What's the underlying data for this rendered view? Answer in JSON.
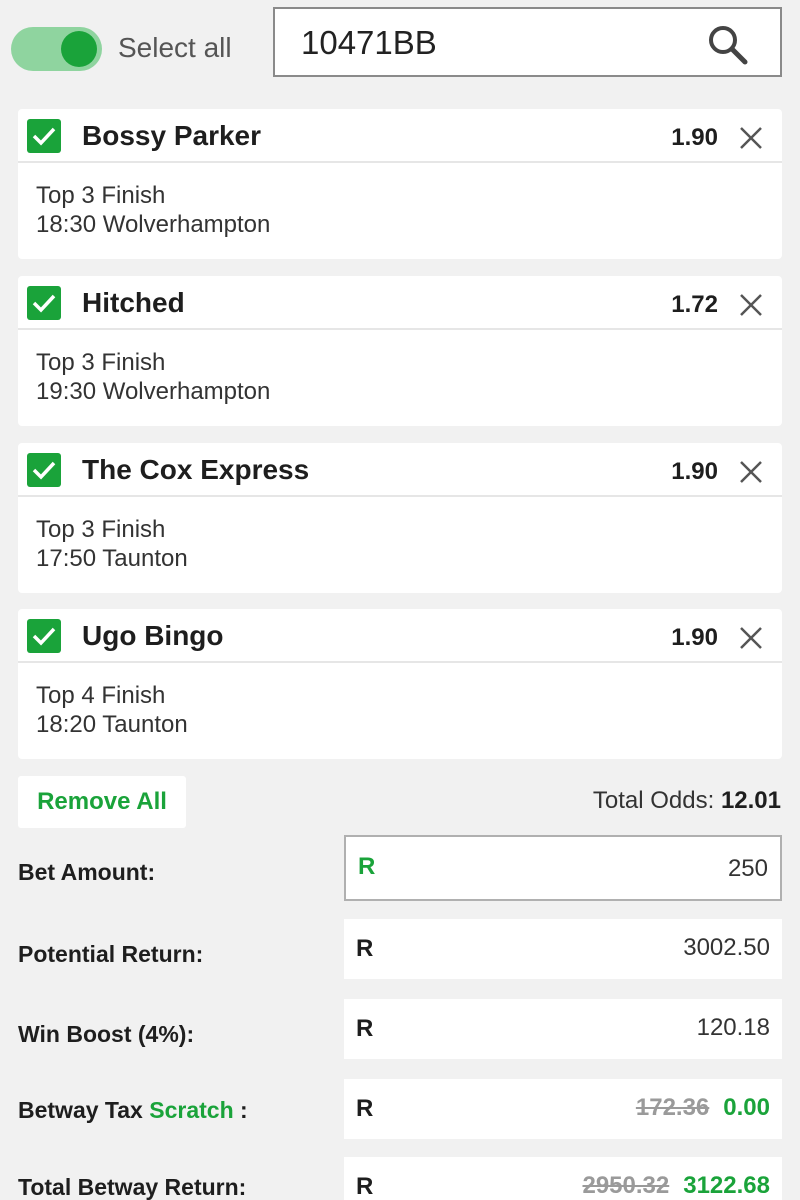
{
  "header": {
    "select_all_label": "Select all",
    "search_value": "10471BB"
  },
  "selections": [
    {
      "name": "Bossy Parker",
      "odds": "1.90",
      "market": "Top 3 Finish",
      "event": "18:30 Wolverhampton"
    },
    {
      "name": "Hitched",
      "odds": "1.72",
      "market": "Top 3 Finish",
      "event": "19:30 Wolverhampton"
    },
    {
      "name": "The Cox Express",
      "odds": "1.90",
      "market": "Top 3 Finish",
      "event": "17:50 Taunton"
    },
    {
      "name": "Ugo Bingo",
      "odds": "1.90",
      "market": "Top 4 Finish",
      "event": "18:20 Taunton"
    }
  ],
  "actions": {
    "remove_all_label": "Remove All",
    "total_odds_label": "Total Odds:",
    "total_odds_value": "12.01"
  },
  "summary": {
    "currency": "R",
    "bet_amount_label": "Bet Amount:",
    "bet_amount_value": "250",
    "potential_return_label": "Potential Return:",
    "potential_return_value": "3002.50",
    "win_boost_label": "Win Boost (4%):",
    "win_boost_value": "120.18",
    "tax_label": "Betway Tax",
    "tax_scratch": "Scratch",
    "tax_colon": " :",
    "tax_old": "172.36",
    "tax_new": "0.00",
    "total_label": "Total Betway Return:",
    "total_old": "2950.32",
    "total_new": "3122.68"
  },
  "colors": {
    "accent": "#1aa33a",
    "toggle_track": "#8fd49f",
    "background": "#f1f1f1"
  },
  "icons": {
    "search": "search-icon",
    "check": "check-icon",
    "close": "close-icon"
  }
}
